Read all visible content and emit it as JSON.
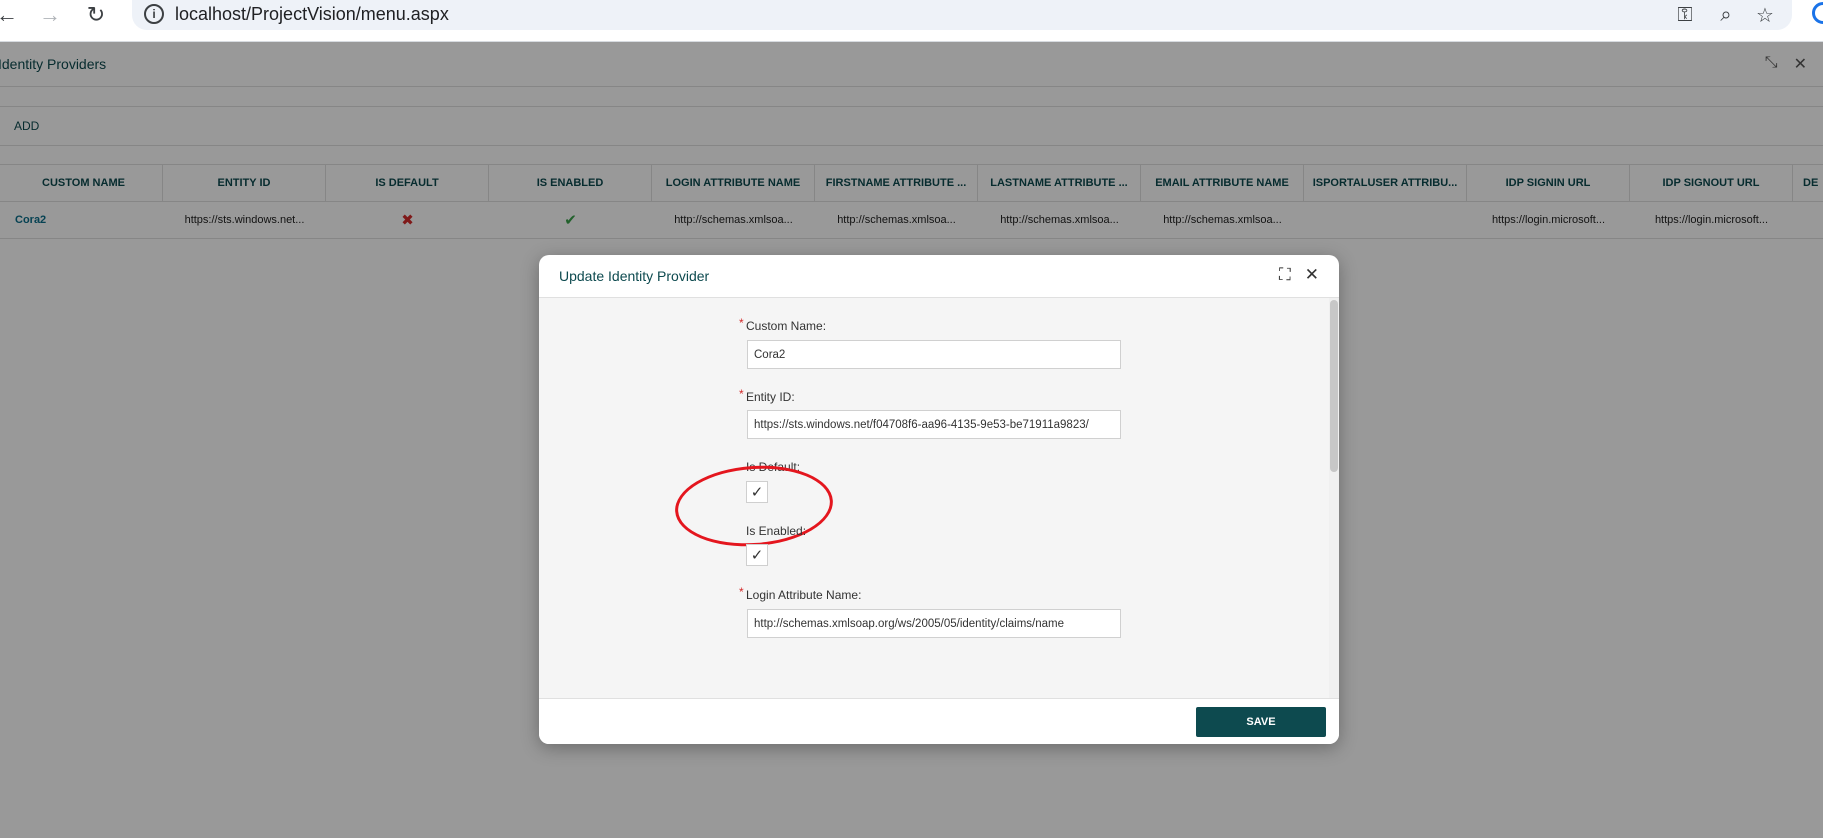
{
  "browser": {
    "url": "localhost/ProjectVision/menu.aspx",
    "icons": [
      "back-arrow-icon",
      "forward-arrow-icon",
      "reload-icon",
      "info-icon",
      "key-icon",
      "zoom-icon",
      "star-icon"
    ]
  },
  "panel": {
    "title": "Identity Providers",
    "add_label": "ADD"
  },
  "grid": {
    "columns": [
      "CUSTOM NAME",
      "ENTITY ID",
      "IS DEFAULT",
      "IS ENABLED",
      "LOGIN ATTRIBUTE NAME",
      "FIRSTNAME ATTRIBUTE ...",
      "LASTNAME ATTRIBUTE ...",
      "EMAIL ATTRIBUTE NAME",
      "ISPORTALUSER ATTRIBU...",
      "IDP SIGNIN URL",
      "IDP SIGNOUT URL",
      "DE"
    ],
    "rows": [
      {
        "custom_name": "Cora2",
        "entity_id": "https://sts.windows.net...",
        "is_default": "✖",
        "is_enabled": "✔",
        "login_attr": "http://schemas.xmlsoa...",
        "firstname_attr": "http://schemas.xmlsoa...",
        "lastname_attr": "http://schemas.xmlsoa...",
        "email_attr": "http://schemas.xmlsoa...",
        "isportaluser_attr": "",
        "signin_url": "https://login.microsoft...",
        "signout_url": "https://login.microsoft...",
        "last": ""
      }
    ]
  },
  "dialog": {
    "title": "Update Identity Provider",
    "fields": {
      "custom_name_label": "Custom Name:",
      "custom_name_value": "Cora2",
      "entity_id_label": "Entity ID:",
      "entity_id_value": "https://sts.windows.net/f04708f6-aa96-4135-9e53-be71911a9823/",
      "is_default_label": "Is Default:",
      "is_default_checked": true,
      "is_enabled_label": "Is Enabled:",
      "is_enabled_checked": true,
      "login_attr_label": "Login Attribute Name:",
      "login_attr_value": "http://schemas.xmlsoap.org/ws/2005/05/identity/claims/name"
    },
    "required_marker": "*",
    "save_label": "SAVE"
  },
  "colors": {
    "accent": "#0d4a4f",
    "required": "#d42b2b",
    "annotation": "#e4161e"
  }
}
